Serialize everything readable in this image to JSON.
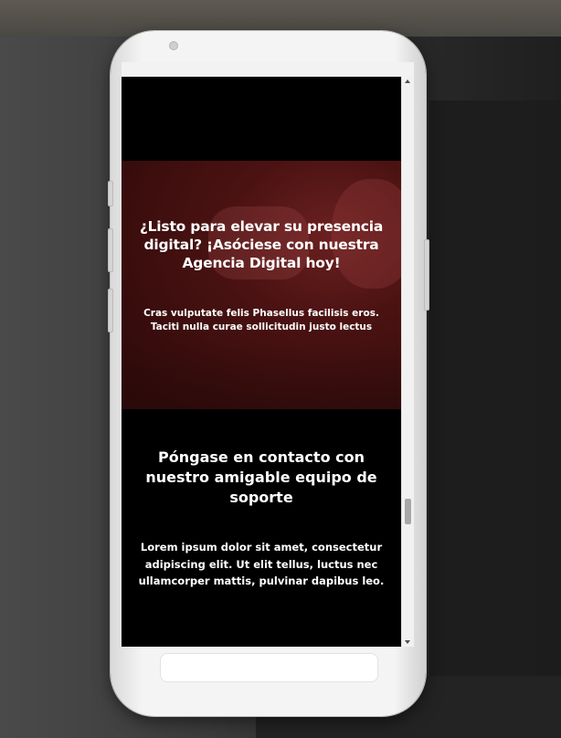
{
  "hero": {
    "title": "¿Listo para elevar su presencia digital? ¡Asóciese con nuestra Agencia Digital hoy!",
    "text": "Cras vulputate felis Phasellus facilisis eros. Taciti nulla curae sollicitudin justo lectus"
  },
  "contact": {
    "title": "Póngase en contacto con nuestro amigable equipo de soporte",
    "text": "Lorem ipsum dolor sit amet, consectetur adipiscing elit. Ut elit tellus, luctus nec ullamcorper mattis, pulvinar dapibus leo."
  },
  "icons": {
    "scroll_up": "scroll-up-arrow-icon",
    "scroll_down": "scroll-down-arrow-icon"
  },
  "scrollbar": {
    "position": 0.78
  },
  "colors": {
    "page_background": "#000000",
    "hero_tint": "#4b1212",
    "text": "#ffffff",
    "device": "#f4f4f4"
  }
}
